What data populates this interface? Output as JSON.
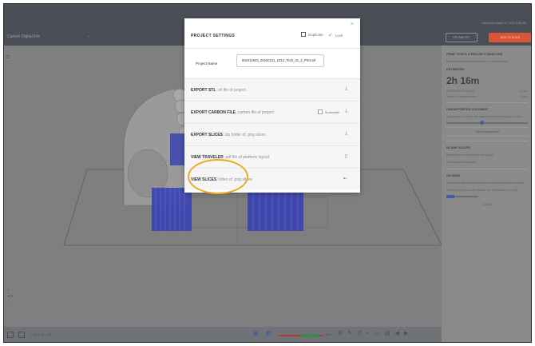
{
  "topbar": {
    "project_title": "Carbon Digital File",
    "saved_status": "Last saved March 17, 2022 8:35 AM",
    "upload_button": "UPLOAD STL",
    "add_button": "ADD TO BUILD"
  },
  "bottombar": {
    "coords": "x 153 y 36 z 33",
    "percent": "43%"
  },
  "right_panel": {
    "print_stats_title": "PRINT STATS & PROJECT ANALYSIS",
    "print_stats_desc": "Estimated print time and volume for current layout.",
    "estimate_label": "ESTIMATES",
    "print_time": "2h 16m",
    "resin_volume_label": "RESIN WITH VOLUME",
    "resin_volume_value": "31 mL",
    "support_volume_label": "Total but support volume",
    "support_volume_value": "14 mL",
    "unsupported_title": "UNSUPPORTED VOLUMES",
    "unsupported_desc": "Unsupported volumes are regions that need supports to print.",
    "show_button": "Show unsupported",
    "blank_title": "BLANK SLICES",
    "blank_desc": "Blank slices are detected in the layout.",
    "blank_status": "No blank slices detected",
    "islands_title": "ISLANDS",
    "islands_desc": "Islands are disconnected regions of the part that print in mid-air.",
    "islands_status": "We found 11 slices with islands. The first island is on slice 1.",
    "pager": "1 of 24"
  },
  "modal": {
    "title": "PROJECT SETTINGS",
    "duplicate_label": "Duplicate",
    "lock_label": "Lock",
    "project_name_label": "Project Name",
    "project_name_value": "801011942_20220211_1012_Tech_01_2_Print.stl",
    "rows": [
      {
        "title": "EXPORT STL",
        "desc": ".stl file of project",
        "action_icon": "download-icon"
      },
      {
        "title": "EXPORT CARBON FILE",
        "desc": ".carbon file of project",
        "action_icon": "download-icon",
        "shareable_label": "Shareable"
      },
      {
        "title": "EXPORT SLICES",
        "desc": ".zip folder of .png slices",
        "action_icon": "download-icon"
      },
      {
        "title": "VIEW TRAVELER",
        "desc": ".pdf file of platform layout",
        "action_icon": "document-icon"
      },
      {
        "title": "VIEW SLICES",
        "desc": "Video of .png slices",
        "action_icon": "arrow-icon"
      }
    ]
  },
  "colors": {
    "accent_orange": "#f0a81f",
    "add_button": "#d9563b",
    "lock_check": "#2f9ad6",
    "part_blue": "#3a44b0"
  }
}
